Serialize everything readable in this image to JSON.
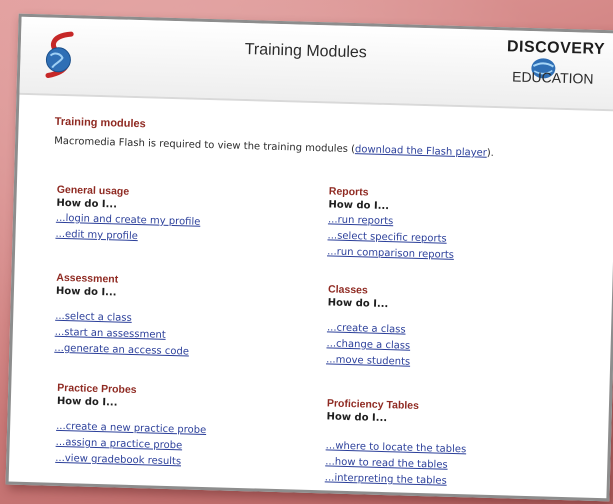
{
  "header": {
    "title": "Training Modules",
    "brand_top": "DISCOVERY",
    "brand_bottom": "EDUCATION"
  },
  "intro": {
    "title": "Training modules",
    "text_before": "Macromedia Flash is required to view the training modules (",
    "link": "download the Flash player",
    "text_after": ")."
  },
  "sections": {
    "general": {
      "title": "General usage",
      "howto": "How do I...",
      "links": [
        "...login and create my profile",
        "...edit my profile"
      ]
    },
    "assessment": {
      "title": "Assessment",
      "howto": "How do I...",
      "links": [
        "...select a class",
        "...start an assessment",
        "...generate an access code"
      ]
    },
    "practice": {
      "title": "Practice Probes",
      "howto": "How do I...",
      "links": [
        "...create a new practice probe",
        "...assign a practice probe",
        "...view gradebook results"
      ]
    },
    "reports": {
      "title": "Reports",
      "howto": "How do I...",
      "links": [
        "...run reports",
        "...select specific reports",
        "...run comparison reports"
      ]
    },
    "classes": {
      "title": "Classes",
      "howto": "How do I...",
      "links": [
        "...create a class",
        "...change a class",
        "...move students"
      ]
    },
    "proficiency": {
      "title": "Proficiency Tables",
      "howto": "How do I...",
      "links": [
        "...where to locate the tables",
        "...how to read the tables",
        "...interpreting the tables"
      ]
    }
  },
  "colors": {
    "heading": "#8f2a22",
    "link": "#2b3f9a",
    "background": "#cf7f7e"
  }
}
